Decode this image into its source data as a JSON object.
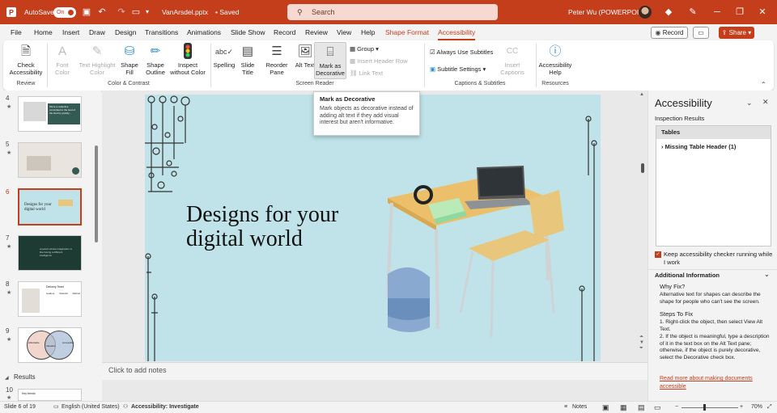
{
  "titlebar": {
    "autosave_label": "AutoSave",
    "autosave_state": "On",
    "filename": "VanArsdel.pptx",
    "save_status": "• Saved",
    "search_placeholder": "Search",
    "user": "Peter Wu (POWERPOINT)",
    "bg_color": "#c43e1c"
  },
  "menu": {
    "items": [
      "File",
      "Home",
      "Insert",
      "Draw",
      "Design",
      "Transitions",
      "Animations",
      "Slide Show",
      "Record",
      "Review",
      "View",
      "Help",
      "Shape Format",
      "Accessibility"
    ],
    "record_label": "Record",
    "share_label": "Share"
  },
  "ribbon": {
    "check_accessibility": "Check Accessibility",
    "font_color": "Font Color",
    "text_highlight_color": "Text Highlight Color",
    "shape_fill": "Shape Fill",
    "shape_outline": "Shape Outline",
    "inspect_without_color": "Inspect without Color",
    "spelling": "Spelling",
    "slide_title": "Slide Title",
    "reorder_pane": "Reorder Pane",
    "alt_text": "Alt Text",
    "mark_as_decorative": "Mark as Decorative",
    "group": "Group",
    "insert_header_row": "Insert Header Row",
    "link_text": "Link Text",
    "always_use_subtitles": "Always Use Subtitles",
    "subtitle_settings": "Subtitle Settings",
    "insert_captions": "Insert Captions",
    "accessibility_help": "Accessibility Help",
    "groups": {
      "review": "Review",
      "color_contrast": "Color & Contrast",
      "screen_reader": "Screen Reader",
      "captions_subtitles": "Captions & Subtitles",
      "resources": "Resources"
    }
  },
  "tooltip": {
    "title": "Mark as Decorative",
    "body": "Mark objects as decorative instead of adding alt text if they add visual interest but aren't informative."
  },
  "thumbnails": {
    "slides": [
      {
        "num": "4",
        "text": "We're a collective committed to the best of the best by quickly..."
      },
      {
        "num": "5",
        "text": ""
      },
      {
        "num": "6",
        "text": "Designs for your digital world"
      },
      {
        "num": "7",
        "text": "A parent whose imagination is like having a different intelligence"
      },
      {
        "num": "8",
        "text": "Delivery Team"
      },
      {
        "num": "9",
        "text": ""
      }
    ],
    "section_label": "Results",
    "slide10_num": "10",
    "slide10_text": "Key trends",
    "slide8_cols": [
      "Leaders",
      "Scientist",
      "Method"
    ],
    "venn_labels": [
      "Affordable",
      "Valuable",
      "Accessible"
    ]
  },
  "slide": {
    "title_line1": "Designs for your",
    "title_line2": "digital world",
    "bg_color": "#bfe3e8"
  },
  "notes_placeholder": "Click to add notes",
  "pane": {
    "title": "Accessibility",
    "inspection_results": "Inspection Results",
    "tables_header": "Tables",
    "issue": "Missing Table Header (1)",
    "keep_running": "Keep accessibility checker running while I work",
    "additional_info": "Additional Information",
    "why_fix_heading": "Why Fix?",
    "why_fix_text": "Alternative text for shapes can describe the shape for people who can't see the screen.",
    "steps_heading": "Steps To Fix",
    "step1": "1. Right-click the object, then select View Alt Text.",
    "step2": "2. If the object is meaningful, type a description of it in the text box on the Alt Text pane; otherwise, if the object is purely decorative, select the Decorative check box.",
    "read_more": "Read more about making documents accessible"
  },
  "status": {
    "slide_count": "Slide 6 of 19",
    "language": "English (United States)",
    "accessibility": "Accessibility: Investigate",
    "notes": "Notes",
    "zoom": "70%"
  }
}
